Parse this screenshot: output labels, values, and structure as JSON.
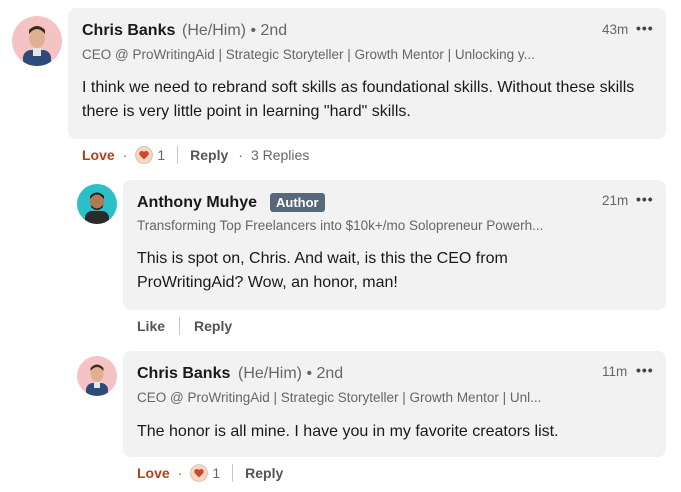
{
  "comments": [
    {
      "name": "Chris Banks",
      "pronouns": "(He/Him) • 2nd",
      "headline": "CEO @ ProWritingAid | Strategic Storyteller | Growth Mentor | Unlocking y...",
      "time": "43m",
      "more": "•••",
      "text": "I think we need to rebrand soft skills as foundational skills. Without these skills there is very little point in learning \"hard\" skills.",
      "reaction_label": "Love",
      "reaction_count": "1",
      "reply_label": "Reply",
      "replies_label": "3 Replies"
    },
    {
      "name": "Anthony Muhye",
      "badge": "Author",
      "headline": "Transforming Top Freelancers into $10k+/mo Solopreneur Powerh...",
      "time": "21m",
      "more": "•••",
      "text": "This is spot on, Chris. And wait, is this the CEO from ProWritingAid? Wow, an honor, man!",
      "like_label": "Like",
      "reply_label": "Reply"
    },
    {
      "name": "Chris Banks",
      "pronouns": "(He/Him) • 2nd",
      "headline": "CEO @ ProWritingAid | Strategic Storyteller | Growth Mentor | Unl...",
      "time": "11m",
      "more": "•••",
      "text": "The honor is all mine. I have you in my favorite creators list.",
      "reaction_label": "Love",
      "reaction_count": "1",
      "reply_label": "Reply"
    }
  ],
  "colors": {
    "bubble": "#f2f2f2",
    "love": "#b24020",
    "badge": "#56687a",
    "avatar_bg_chris": "#f5c3c3",
    "avatar_bg_anthony": "#2bc0c8"
  },
  "icons": {
    "reaction": "heart-reaction-icon",
    "more": "more-options-icon"
  }
}
